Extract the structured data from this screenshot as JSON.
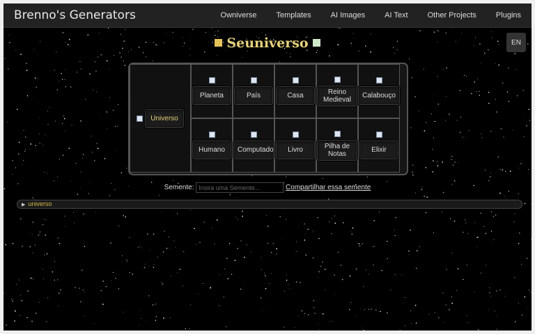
{
  "header": {
    "brand": "Brenno's Generators",
    "nav": [
      "Owniverse",
      "Templates",
      "AI Images",
      "AI Text",
      "Other Projects",
      "Plugins"
    ]
  },
  "lang_button": "EN",
  "title": "Seuniverso",
  "generators": {
    "main": "Universo",
    "row1": [
      "Planeta",
      "País",
      "Casa",
      "Reino Medieval",
      "Calabouço"
    ],
    "row2": [
      "Humano",
      "Computador",
      "Livro",
      "Pilha de Notas",
      "Elixir"
    ]
  },
  "seed": {
    "label": "Semente:",
    "placeholder": "Insira uma Semente...",
    "share": "Compartilhar essa semente"
  },
  "tree": {
    "root": "universo"
  }
}
